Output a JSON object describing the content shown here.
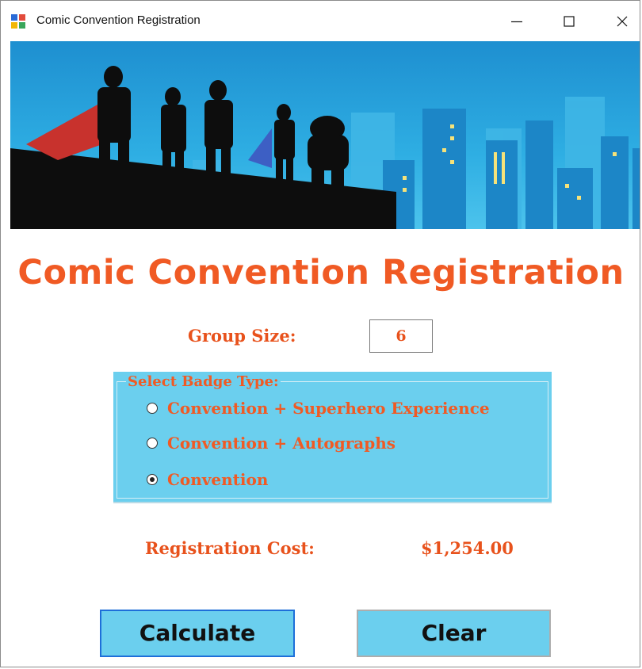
{
  "window": {
    "title": "Comic Convention Registration",
    "controls": {
      "minimize": "—",
      "maximize": "☐",
      "close": "✕"
    }
  },
  "form": {
    "heading": "Comic Convention Registration",
    "group_size_label": "Group Size:",
    "group_size_value": "6",
    "badge_group_title": "Select Badge Type:",
    "badge_options": [
      {
        "label": "Convention + Superhero  Experience",
        "checked": false
      },
      {
        "label": "Convention + Autographs",
        "checked": false
      },
      {
        "label": "Convention",
        "checked": true
      }
    ],
    "cost_label": "Registration Cost:",
    "cost_value": "$1,254.00",
    "calculate_label": "Calculate",
    "clear_label": "Clear"
  },
  "colors": {
    "accent_text": "#f05a24",
    "groupbox_bg": "#6bcfee",
    "button_bg": "#6bcfee",
    "focused_border": "#1e6fd9",
    "banner_sky": "#2aa9e0"
  },
  "icons": {
    "app": "app-window-icon",
    "minimize": "minimize-icon",
    "maximize": "maximize-icon",
    "close": "close-icon"
  }
}
